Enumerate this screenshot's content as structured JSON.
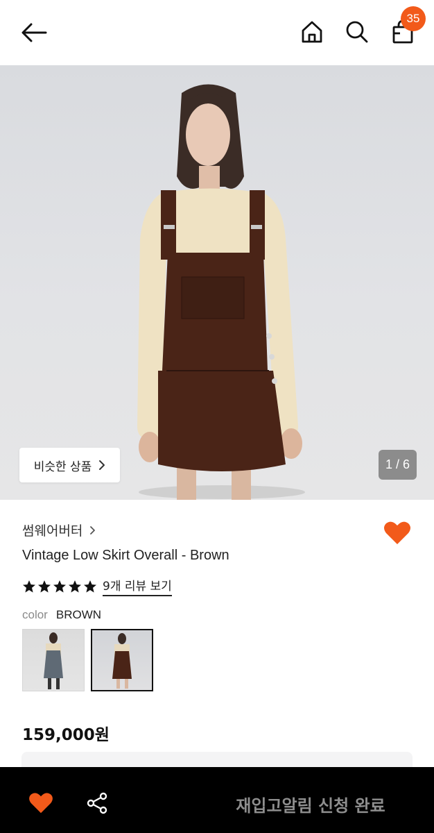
{
  "header": {
    "icons": {
      "back": "arrow-left-icon",
      "home": "home-icon",
      "search": "search-icon",
      "bag": "shopping-bag-icon"
    },
    "cart_count": "35"
  },
  "hero": {
    "similar_label": "비슷한 상품",
    "similar_icon": "chevron-right-icon",
    "page_indicator": "1 / 6"
  },
  "product": {
    "brand": "썸웨어버터",
    "title": "Vintage Low Skirt Overall - Brown",
    "rating_stars": 5,
    "review_link": "9개 리뷰 보기",
    "color_label": "color",
    "color_value": "BROWN",
    "price": "159,000원",
    "favorited": true
  },
  "bottom_bar": {
    "status_label": "재입고알림 신청 완료",
    "icons": {
      "wishlist": "heart-icon",
      "share": "share-icon"
    }
  },
  "colors": {
    "accent": "#F25A1A",
    "bottom_bar_bg": "#000000",
    "status_text": "#8E8E8E"
  }
}
